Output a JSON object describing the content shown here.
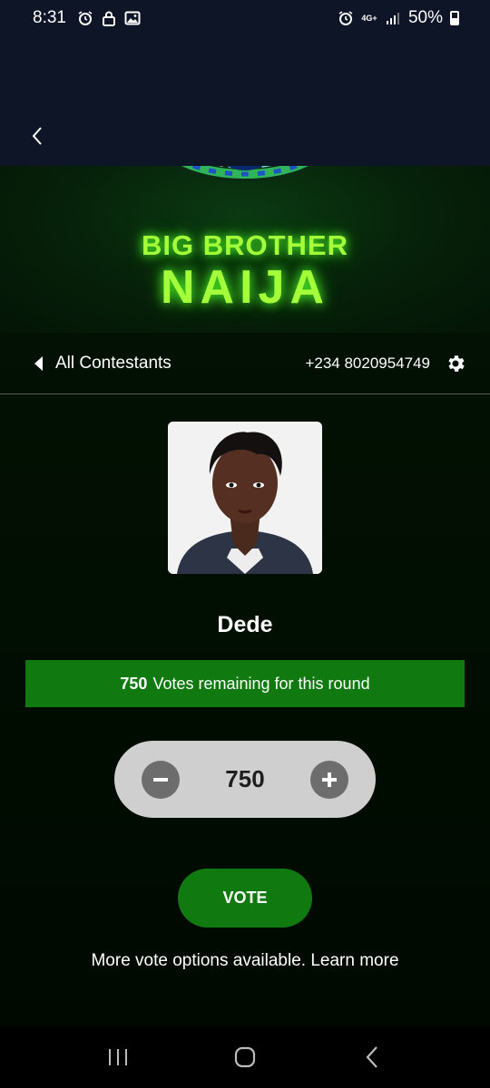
{
  "status_bar": {
    "time": "8:31",
    "icons_left": [
      "alarm-icon",
      "lock-icon",
      "image-icon"
    ],
    "icons_right": [
      "alarm-icon",
      "network-4g-icon",
      "signal-icon"
    ],
    "network_label": "4G+",
    "battery": "50%"
  },
  "banner": {
    "line1": "BIG BROTHER",
    "line2": "NAIJA",
    "colors": {
      "glow": "#a4ff3a",
      "background": "#062009"
    }
  },
  "nav": {
    "back_label": "All Contestants",
    "phone": "+234 8020954749",
    "settings_icon": "gear-icon"
  },
  "contestant": {
    "name": "Dede"
  },
  "votes": {
    "remaining_count": "750",
    "remaining_text": "Votes remaining for this round"
  },
  "stepper": {
    "value": "750",
    "decrement_icon": "minus-icon",
    "increment_icon": "plus-icon"
  },
  "actions": {
    "vote_label": "VOTE",
    "more_text": "More vote options available.",
    "learn_more": "Learn more"
  },
  "system_nav": [
    "recents-icon",
    "home-icon",
    "back-icon"
  ],
  "colors": {
    "accent_green": "#107a10",
    "header_bg": "#0d1527",
    "stepper_bg": "#cfcfcf"
  }
}
